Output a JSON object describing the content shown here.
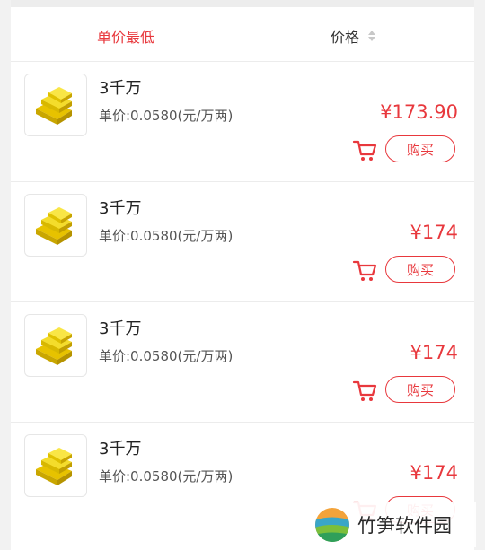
{
  "sort": {
    "unit_price_label": "单价最低",
    "price_label": "价格"
  },
  "items": [
    {
      "title": "3千万",
      "unit_price": "单价:0.0580(元/万两)",
      "price": "¥173.90",
      "buy_label": "购买"
    },
    {
      "title": "3千万",
      "unit_price": "单价:0.0580(元/万两)",
      "price": "¥174",
      "buy_label": "购买"
    },
    {
      "title": "3千万",
      "unit_price": "单价:0.0580(元/万两)",
      "price": "¥174",
      "buy_label": "购买"
    },
    {
      "title": "3千万",
      "unit_price": "单价:0.0580(元/万两)",
      "price": "¥174",
      "buy_label": "购买"
    }
  ],
  "watermark": {
    "text": "竹笋软件园"
  },
  "icons": {
    "product": "gold-bars-icon",
    "cart": "cart-icon",
    "sort": "sort-arrows-icon",
    "logo": "site-logo-icon"
  },
  "colors": {
    "accent": "#e8383d",
    "gold": "#f2d21b"
  }
}
